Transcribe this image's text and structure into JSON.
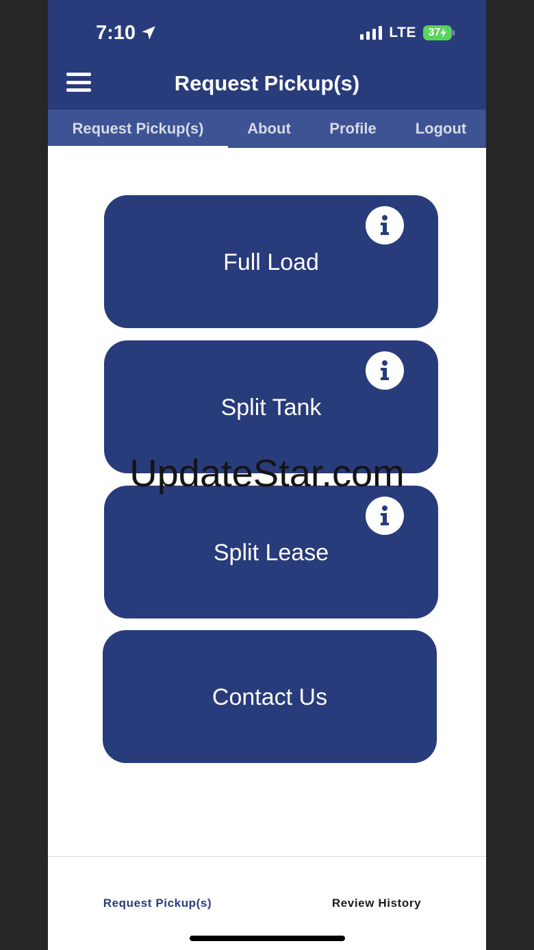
{
  "status_bar": {
    "time": "7:10",
    "network": "LTE",
    "battery": "37"
  },
  "header": {
    "title": "Request Pickup(s)"
  },
  "tabs": [
    {
      "label": "Request Pickup(s)"
    },
    {
      "label": "About"
    },
    {
      "label": "Profile"
    },
    {
      "label": "Logout"
    }
  ],
  "cards": [
    {
      "label": "Full Load"
    },
    {
      "label": "Split Tank"
    },
    {
      "label": "Split Lease"
    },
    {
      "label": "Contact Us"
    }
  ],
  "watermark": "UpdateStar.com",
  "bottom_tabs": [
    {
      "label": "Request Pickup(s)"
    },
    {
      "label": "Review History"
    }
  ],
  "colors": {
    "primary": "#283b7a",
    "tab_bar": "#3e5394",
    "active_bottom_tab": "#283b7a",
    "inactive_bottom_tab": "#1a1a1a",
    "battery": "#5ad35a"
  }
}
